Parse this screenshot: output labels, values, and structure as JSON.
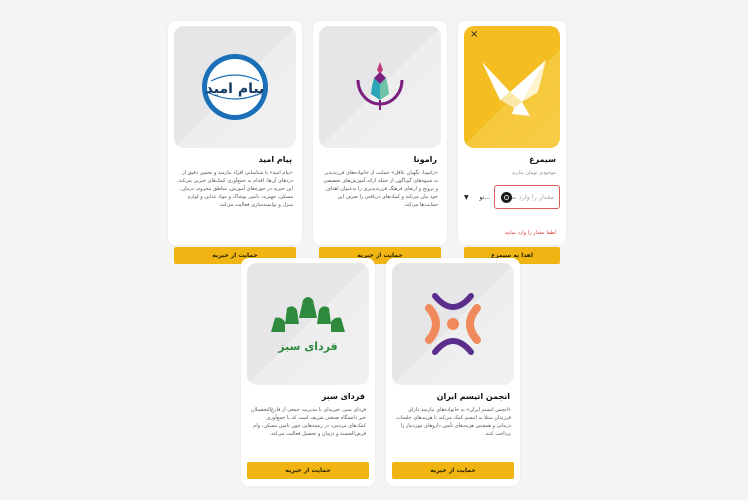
{
  "colors": {
    "accent": "#f0b512",
    "error": "#d83a3a",
    "background": "#f4f4f5"
  },
  "cards": [
    {
      "title": "سیمرغ",
      "muted": "موجودی تومان ندارید",
      "input_placeholder": "مقدار را وارد نمایید",
      "currency": "تو...",
      "error": "لطفا مقدار را وارد نمایید",
      "button": "اهدا به سیمرغ",
      "close": "×"
    },
    {
      "title": "رامونا",
      "desc": "«رامونا، نگهبان عاقل» حمایت از خانواده‌های فرزندپذیر به شیوه‌های گوناگون از جمله ارائه آموزش‌های تخصصی و ترویج و ارتقای فرهنگ فرزندپذیری را به‌عنوان اهداف خود بیان می‌کند و کمک‌های دریافتی را صرف این حمایت‌ها می‌کند.",
      "button": "حمایت از خیریه"
    },
    {
      "title": "پیام امید",
      "desc": "«پیام امید» با شناسایی افراد نیازمند و تخمین دقیق از درد‌ها‌ی آن‌ها، اقدام به جمع‌آوری کمک‌های خیرین می‌کند. این خیریه در حوزه‌های آموزش، مناطق محروم، درمان، مسکن، جهیزیه، تامین پوشاک و مواد غذایی و لوازم منزل و توانمندسازی فعالیت می‌کند.",
      "button": "حمایت از خیریه",
      "logo_text": "پیام امید"
    },
    {
      "title": "انجمن اتیسم ایران",
      "desc": "«انجمن اتیسم ایران» به خانواده‌های نیازمند دارای فرزندان مبتلا به اتیسم کمک می‌کند تا هزینه‌های جلسات درمانی و همچنین هزینه‌های تأمین داروهای موردنیاز را پرداخت کنند.",
      "button": "حمایت از خیریه"
    },
    {
      "title": "فردای سبز",
      "desc": "فردای سبز، خیریه‌ای با مدیریت جمعی از فارغ‌التحصیلان خیر دانشگاه صنعتی شریف است که با جمع‌آوری کمک‌های مردمی، در زمینه‌هایی چون تامین مسکن، وام قرض‌الحسنه و درمان و تحصیل فعالیت می‌کند.",
      "button": "حمایت از خیریه",
      "logo_text": "فردای سبز"
    }
  ]
}
